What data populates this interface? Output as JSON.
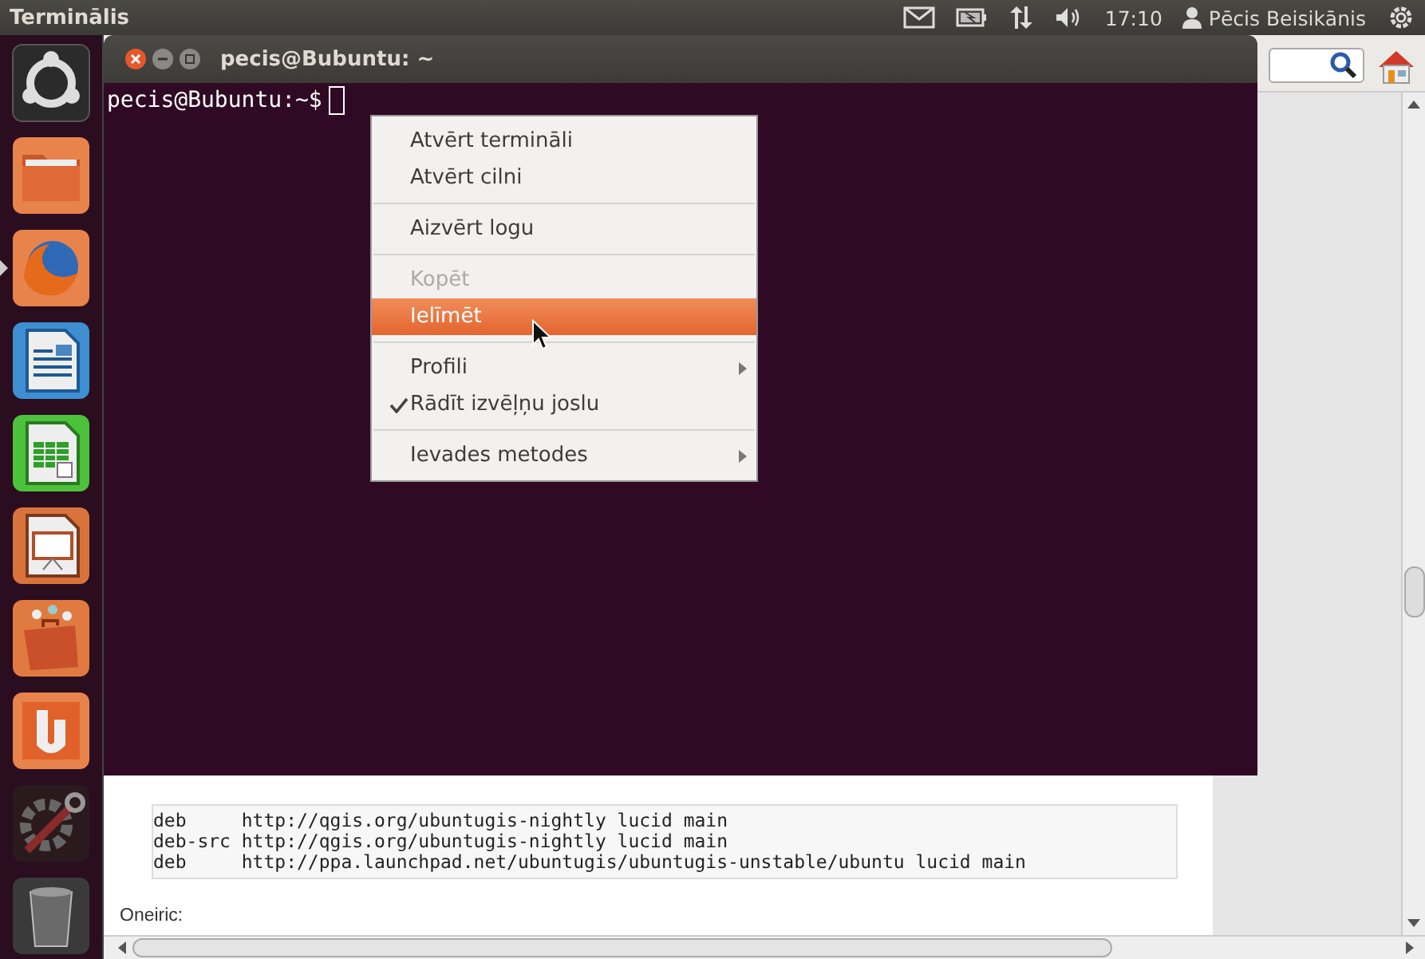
{
  "top_panel": {
    "app_title": "Terminālis",
    "clock": "17:10",
    "user": "Pēcis Beisikānis"
  },
  "launcher": {
    "items": [
      {
        "kind": "dash",
        "running": false
      },
      {
        "kind": "files",
        "running": false
      },
      {
        "kind": "browser",
        "running": true
      },
      {
        "kind": "writer",
        "running": false
      },
      {
        "kind": "calc",
        "running": false
      },
      {
        "kind": "impress",
        "running": false
      },
      {
        "kind": "software",
        "running": false
      },
      {
        "kind": "ubuntuone",
        "running": false
      },
      {
        "kind": "settings",
        "running": false
      },
      {
        "kind": "trash",
        "running": false
      }
    ]
  },
  "browser": {
    "code_lines": [
      "deb     http://qgis.org/ubuntugis-nightly lucid main",
      "deb-src http://qgis.org/ubuntugis-nightly lucid main",
      "deb     http://ppa.launchpad.net/ubuntugis/ubuntugis-unstable/ubuntu lucid main"
    ],
    "section_label": "Oneiric:"
  },
  "terminal": {
    "title": "pecis@Bubuntu: ~",
    "prompt": "pecis@Bubuntu:~$"
  },
  "context_menu": {
    "items": [
      {
        "kind": "item",
        "label": "Atvērt termināli",
        "disabled": false,
        "selected": false,
        "checked": false,
        "submenu": false
      },
      {
        "kind": "item",
        "label": "Atvērt cilni",
        "disabled": false,
        "selected": false,
        "checked": false,
        "submenu": false
      },
      {
        "kind": "separator"
      },
      {
        "kind": "item",
        "label": "Aizvērt logu",
        "disabled": false,
        "selected": false,
        "checked": false,
        "submenu": false
      },
      {
        "kind": "separator"
      },
      {
        "kind": "item",
        "label": "Kopēt",
        "disabled": true,
        "selected": false,
        "checked": false,
        "submenu": false
      },
      {
        "kind": "item",
        "label": "Ielīmēt",
        "disabled": false,
        "selected": true,
        "checked": false,
        "submenu": false
      },
      {
        "kind": "separator"
      },
      {
        "kind": "item",
        "label": "Profili",
        "disabled": false,
        "selected": false,
        "checked": false,
        "submenu": true
      },
      {
        "kind": "item",
        "label": "Rādīt izvēļņu joslu",
        "disabled": false,
        "selected": false,
        "checked": true,
        "submenu": false
      },
      {
        "kind": "separator"
      },
      {
        "kind": "item",
        "label": "Ievades metodes",
        "disabled": false,
        "selected": false,
        "checked": false,
        "submenu": true
      }
    ]
  }
}
